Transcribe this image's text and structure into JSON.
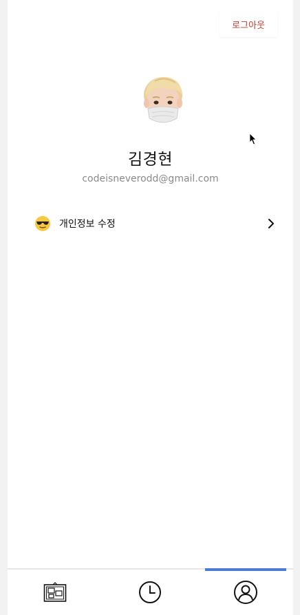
{
  "header": {
    "logout_label": "로그아웃"
  },
  "profile": {
    "name": "김경현",
    "email": "codeisneverodd@gmail.com",
    "avatar_icon": "memoji-avatar"
  },
  "menu": [
    {
      "icon": "sunglasses-emoji-icon",
      "label": "개인정보 수정",
      "trailing_icon": "chevron-right-icon"
    }
  ],
  "tabbar": {
    "tabs": [
      {
        "icon": "board-icon",
        "active": false
      },
      {
        "icon": "clock-icon",
        "active": false
      },
      {
        "icon": "user-icon",
        "active": true
      }
    ],
    "active_color": "#4a79d8"
  },
  "colors": {
    "logout": "#c0392b",
    "email": "#8a8a8a"
  }
}
